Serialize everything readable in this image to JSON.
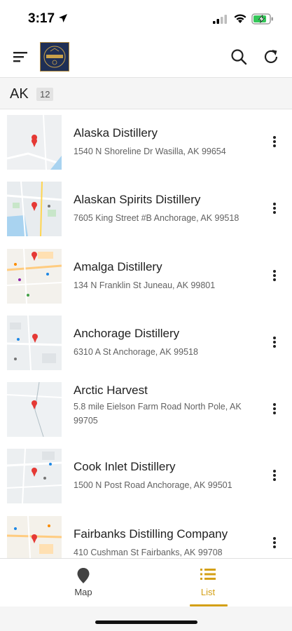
{
  "status_bar": {
    "time": "3:17"
  },
  "app": {
    "logo_alt_text": "DISTILLERY"
  },
  "section": {
    "state": "AK",
    "count": "12"
  },
  "distilleries": [
    {
      "name": "Alaska Distillery",
      "address": "1540 N Shoreline Dr Wasilla, AK 99654"
    },
    {
      "name": "Alaskan Spirits Distillery",
      "address": "7605 King Street #B Anchorage, AK 99518"
    },
    {
      "name": "Amalga Distillery",
      "address": "134 N Franklin St Juneau, AK 99801"
    },
    {
      "name": "Anchorage Distillery",
      "address": "6310 A St Anchorage, AK 99518"
    },
    {
      "name": "Arctic Harvest",
      "address": "5.8 mile Eielson Farm Road North Pole, AK 99705"
    },
    {
      "name": "Cook Inlet Distillery",
      "address": "1500 N Post Road Anchorage, AK 99501"
    },
    {
      "name": "Fairbanks Distilling Company",
      "address": "410 Cushman St Fairbanks, AK 99708"
    }
  ],
  "bottom_nav": {
    "map_label": "Map",
    "list_label": "List"
  },
  "colors": {
    "accent": "#d4a017",
    "pin": "#e53935",
    "logo_bg": "#1f2f55"
  }
}
